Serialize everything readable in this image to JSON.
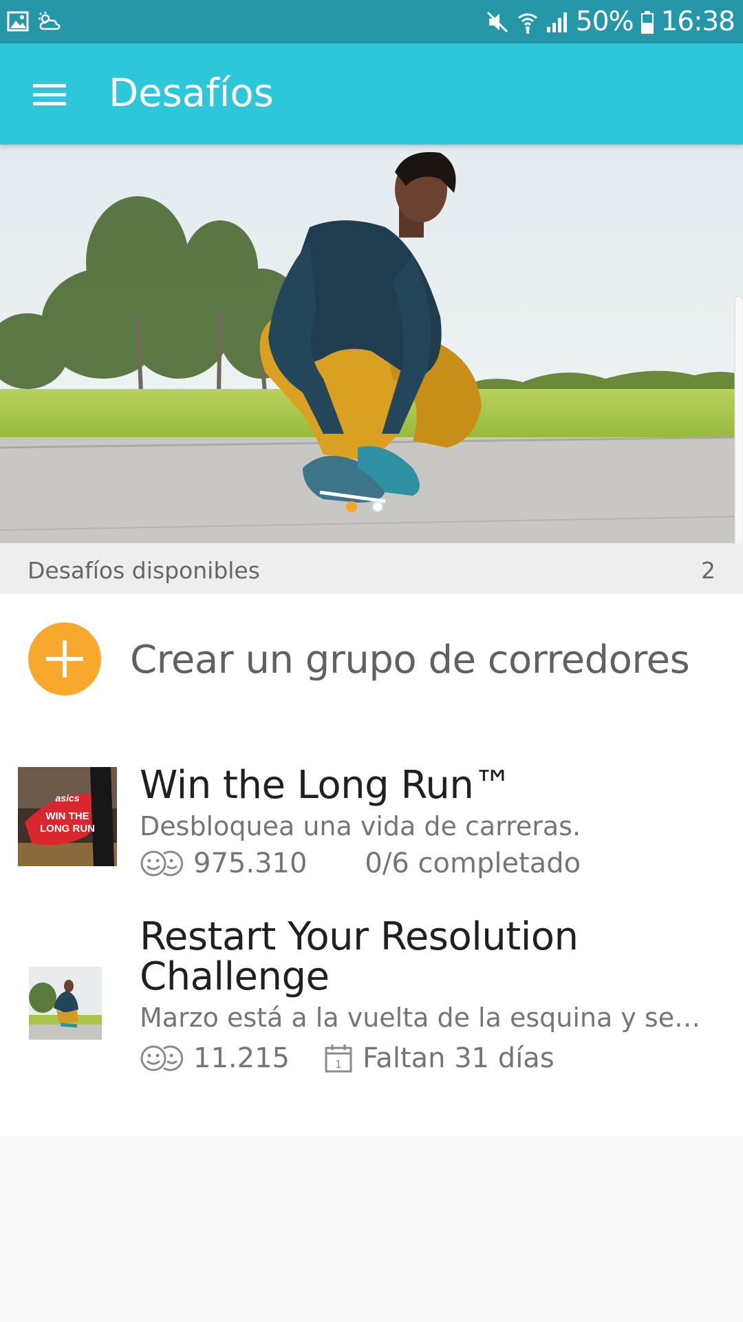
{
  "status_bar": {
    "battery": "50%",
    "time": "16:38"
  },
  "toolbar": {
    "title": "Desafíos"
  },
  "section": {
    "title": "Desafíos disponibles",
    "count": "2"
  },
  "create_group": {
    "label": "Crear un grupo de corredores"
  },
  "challenges": [
    {
      "title": "Win the Long Run™",
      "description": "Desbloquea una vida de carreras.",
      "participants": "975.310",
      "status": "0/6 completado",
      "thumbnail_text": [
        "asics",
        "WIN THE",
        "LONG RUN"
      ]
    },
    {
      "title_line1": "Restart Your Resolution",
      "title_line2": "Challenge",
      "description": "Marzo está a la vuelta de la esquina y segur...",
      "participants": "11.215",
      "status": "Faltan 31 días"
    }
  ],
  "colors": {
    "status_bar": "#2597a9",
    "toolbar": "#2ec6d9",
    "accent": "#f7a82d"
  },
  "carousel": {
    "pages": 2,
    "active_page": 1
  }
}
